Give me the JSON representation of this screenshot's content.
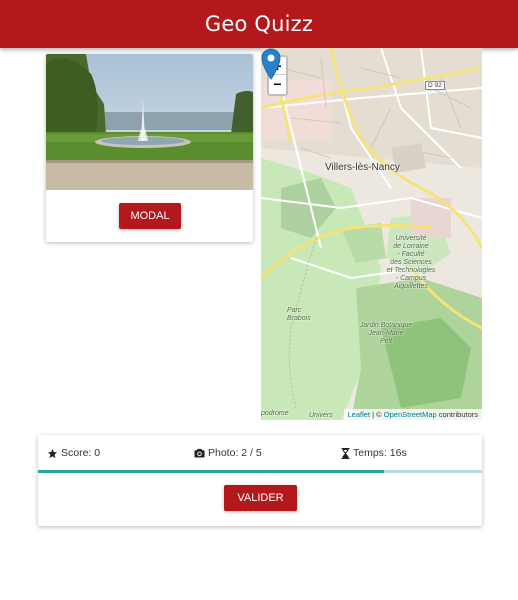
{
  "header": {
    "title": "Geo Quizz"
  },
  "photo_card": {
    "modal_label": "MODAL"
  },
  "map": {
    "zoom_in": "+",
    "zoom_out": "−",
    "labels": {
      "town": "Villers-lès-Nancy",
      "road": "D 92",
      "univ1": "Université",
      "univ2": "de Lorraine",
      "univ3": "- Faculté",
      "univ4": "des Sciences",
      "univ5": "et Technologies",
      "univ6": "- Campus",
      "univ7": "Aiguillettes",
      "parc1": "Parc",
      "parc2": "Brabois",
      "jardin1": "Jardin Botanique",
      "jardin2": "Jean-Marie",
      "jardin3": "Pelt",
      "hippo": "podrome",
      "univers": "Univers"
    },
    "attribution": {
      "leaflet": "Leaflet",
      "sep": " | © ",
      "osm": "OpenStreetMap",
      "rest": " contributors"
    }
  },
  "status": {
    "score": "Score: 0",
    "photo": "Photo: 2 / 5",
    "temps": "Temps: 16s",
    "progress_fraction": 0.78,
    "valider_label": "VALIDER"
  },
  "colors": {
    "primary": "#b3191c",
    "progress": "#26a69a",
    "progress_track": "#b2dfdb"
  },
  "icons": [
    "star-icon",
    "camera-icon",
    "hourglass-icon",
    "map-marker-icon"
  ]
}
